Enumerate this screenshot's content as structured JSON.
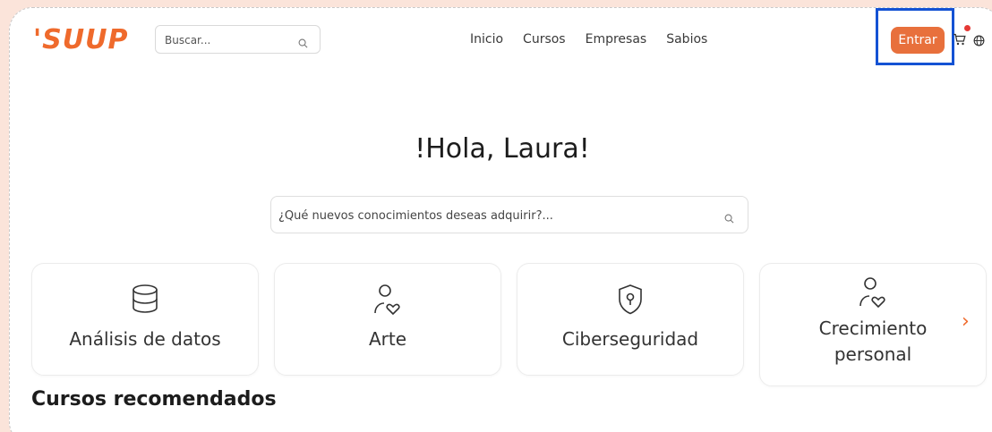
{
  "header": {
    "logo": "'SUUP",
    "search_placeholder": "Buscar...",
    "nav": [
      "Inicio",
      "Cursos",
      "Empresas",
      "Sabios"
    ],
    "login_label": "Entrar"
  },
  "hero": {
    "greeting": "!Hola, Laura!",
    "search_placeholder": "¿Qué nuevos conocimientos deseas adquirir?..."
  },
  "categories": [
    {
      "label": "Análisis de datos",
      "icon": "database-icon"
    },
    {
      "label": "Arte",
      "icon": "person-heart-icon"
    },
    {
      "label": "Ciberseguridad",
      "icon": "shield-lock-icon"
    },
    {
      "label": "Crecimiento personal",
      "icon": "person-heart-icon"
    }
  ],
  "sections": {
    "recommended_title": "Cursos recomendados"
  },
  "colors": {
    "accent": "#ef6a2c",
    "button": "#e8703c",
    "highlight": "#1452d4",
    "background": "#fbe4da"
  }
}
